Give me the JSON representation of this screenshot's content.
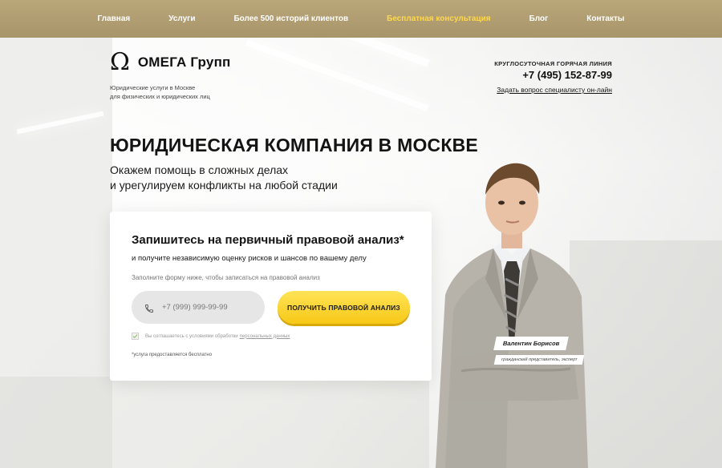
{
  "nav": {
    "items": [
      {
        "label": "Главная"
      },
      {
        "label": "Услуги"
      },
      {
        "label": "Более 500 историй клиентов"
      },
      {
        "label": "Бесплатная консультация"
      },
      {
        "label": "Блог"
      },
      {
        "label": "Контакты"
      }
    ],
    "active_index": 3
  },
  "brand": {
    "symbol": "Ω",
    "name": "ОМЕГА Групп",
    "tagline_line1": "Юридические услуги в Москве",
    "tagline_line2": "для физических и юридических лиц"
  },
  "hotline": {
    "label": "КРУГЛОСУТОЧНАЯ ГОРЯЧАЯ ЛИНИЯ",
    "phone": "+7 (495) 152-87-99",
    "ask_link": "Задать вопрос специалисту он-лайн"
  },
  "hero": {
    "title": "ЮРИДИЧЕСКАЯ КОМПАНИЯ В МОСКВЕ",
    "subtitle_line1": "Окажем помощь в сложных делах",
    "subtitle_line2": "и урегулируем конфликты на любой стадии"
  },
  "form": {
    "heading": "Запишитесь на первичный правовой анализ*",
    "subheading": "и получите независимую оценку рисков и шансов по вашему делу",
    "hint": "Заполните форму ниже, чтобы записаться на правовой анализ",
    "phone_placeholder": "+7 (999) 999-99-99",
    "phone_icon": "phone-icon",
    "submit_label": "ПОЛУЧИТЬ ПРАВОВОЙ АНАЛИЗ",
    "consent_text": "Вы соглашаетесь с условиями обработки",
    "consent_link": "персональных данных",
    "consent_checked": true,
    "footnote": "*услуга предоставляется бесплатно"
  },
  "expert": {
    "name": "Валентин Борисов",
    "role": "гражданский представитель, эксперт"
  },
  "colors": {
    "nav_bg": "#ad9a6e",
    "nav_active": "#ffd84a",
    "cta": "#f9cf1e"
  }
}
